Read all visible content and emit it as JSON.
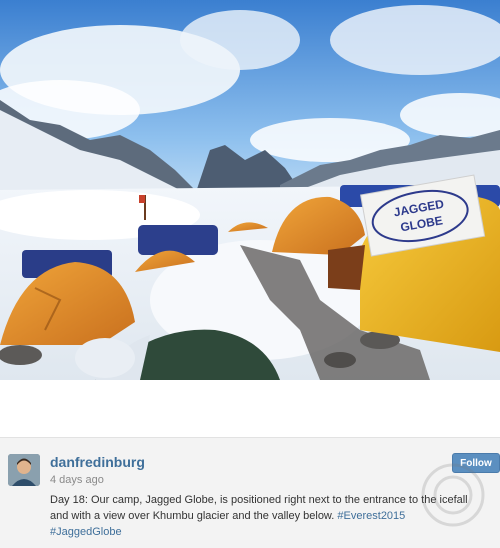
{
  "post": {
    "username": "danfredinburg",
    "timestamp": "4 days ago",
    "caption": "Day 18: Our camp, Jagged Globe, is positioned right next to the entrance to the icefall and with a view over Khumbu glacier and the valley below.",
    "hashtags": [
      "#Everest2015",
      "#JaggedGlobe"
    ],
    "follow_label": "Follow"
  },
  "photo": {
    "banner_text": [
      "JAGGED",
      "GLOBE"
    ]
  },
  "colors": {
    "link": "#3f6f9a",
    "follow_button": "#5b8fc0"
  }
}
